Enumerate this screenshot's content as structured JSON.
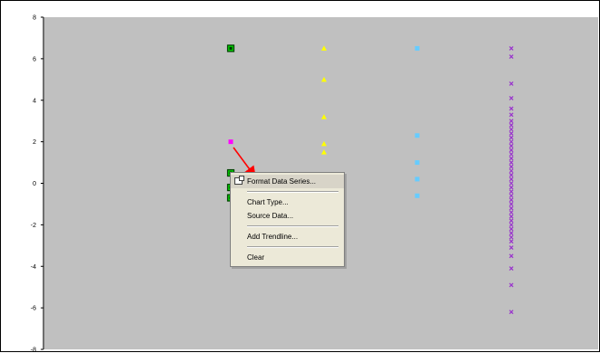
{
  "chart_data": {
    "type": "scatter",
    "title": "",
    "xlabel": "",
    "ylabel": "",
    "ylim": [
      -8,
      8
    ],
    "y_ticks": [
      8,
      6,
      4,
      2,
      0,
      -2,
      -4,
      -6,
      -8
    ],
    "grid": false,
    "plot_background": "#c0c0c0",
    "series": [
      {
        "marker": "square-outline",
        "color": "#00cc00",
        "values": [
          6.5,
          0.5,
          -0.2,
          -0.7
        ]
      },
      {
        "marker": "square",
        "color": "#ff00ff",
        "values": [
          2.0
        ]
      },
      {
        "marker": "triangle",
        "color": "#ffff00",
        "values": [
          6.5,
          5.0,
          3.2,
          1.9,
          1.5
        ]
      },
      {
        "marker": "square",
        "color": "#66ccff",
        "values": [
          6.5,
          2.3,
          1.0,
          0.2,
          -0.6
        ]
      },
      {
        "marker": "x",
        "color": "#9933cc",
        "values": [
          6.5,
          6.1,
          4.8,
          4.1,
          3.6,
          3.3,
          3.0,
          2.8,
          2.6,
          2.4,
          2.2,
          2.0,
          1.8,
          1.6,
          1.4,
          1.2,
          1.0,
          0.8,
          0.6,
          0.4,
          0.2,
          0.0,
          -0.2,
          -0.4,
          -0.6,
          -0.8,
          -1.0,
          -1.2,
          -1.4,
          -1.6,
          -1.8,
          -2.0,
          -2.2,
          -2.4,
          -2.6,
          -2.8,
          -3.1,
          -3.5,
          -4.1,
          -4.9,
          -6.2
        ]
      }
    ]
  },
  "context_menu": {
    "items": [
      {
        "label": "Format Data Series..."
      },
      {
        "label": "Chart Type..."
      },
      {
        "label": "Source Data..."
      },
      {
        "label": "Add Trendline..."
      },
      {
        "label": "Clear"
      }
    ]
  },
  "colors": {
    "arrow": "#ff0000",
    "menu_background": "#ece9d8"
  }
}
